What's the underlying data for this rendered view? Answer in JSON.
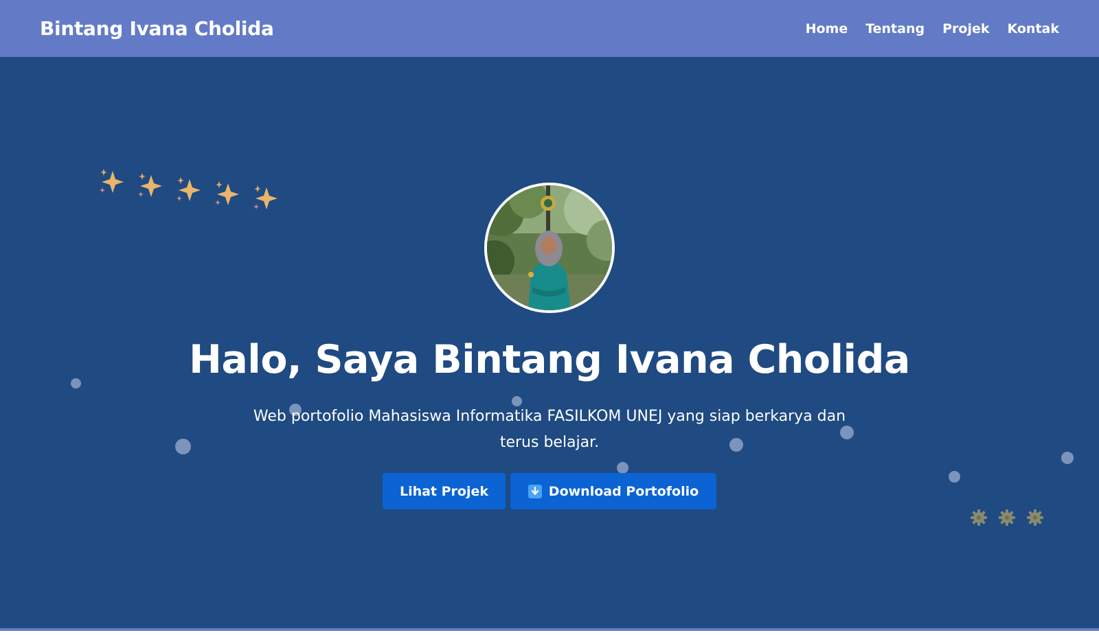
{
  "navbar": {
    "brand": "Bintang Ivana Cholida",
    "links": [
      "Home",
      "Tentang",
      "Projek",
      "Kontak"
    ]
  },
  "hero": {
    "title": "Halo, Saya Bintang Ivana Cholida",
    "subtitle": "Web portofolio Mahasiswa Informatika FASILKOM UNEJ yang siap berkarya dan terus belajar.",
    "buttons": {
      "projects_label": "Lihat Projek",
      "download_label": "Download Portofolio",
      "download_icon": "down-arrow-icon"
    },
    "decorations": {
      "sparkle_count": 5,
      "gear_count": 3
    }
  },
  "colors": {
    "navbar_bg": "#637bc7",
    "hero_bg": "#1f4a82",
    "button_bg": "#0b63d4",
    "text": "#ffffff"
  }
}
